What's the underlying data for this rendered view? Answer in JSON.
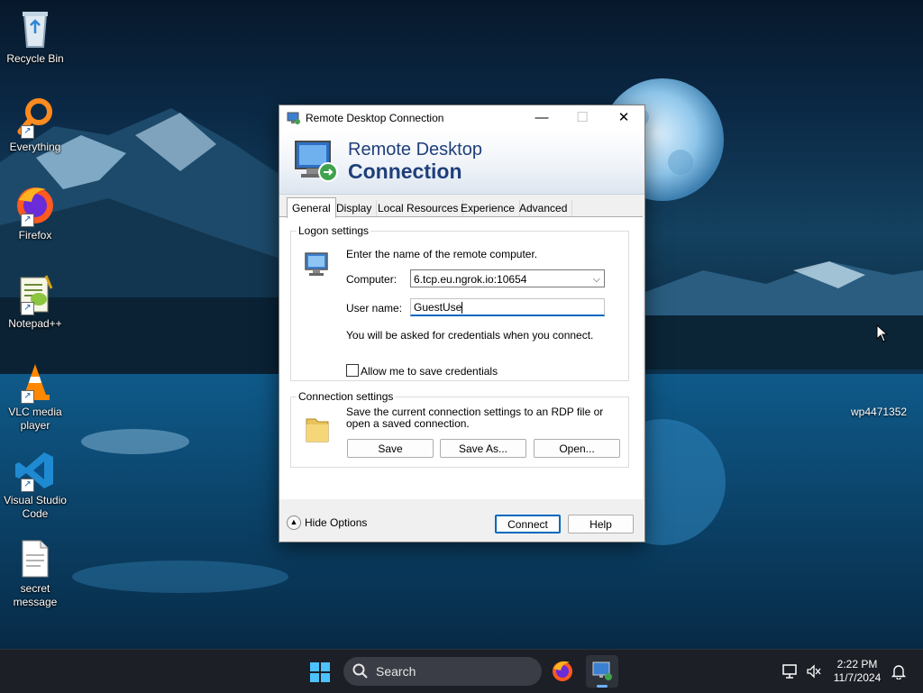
{
  "desktop": {
    "icons": [
      {
        "label": "Recycle Bin",
        "icon": "recycle-bin-icon"
      },
      {
        "label": "Everything",
        "icon": "everything-search-icon"
      },
      {
        "label": "Firefox",
        "icon": "firefox-icon"
      },
      {
        "label": "Notepad++",
        "icon": "notepad-plus-plus-icon"
      },
      {
        "label": "VLC media player",
        "icon": "vlc-cone-icon"
      },
      {
        "label": "Visual Studio Code",
        "icon": "vscode-icon"
      },
      {
        "label": "secret message",
        "icon": "text-document-icon"
      }
    ],
    "wallpaper_label": "wp4471352"
  },
  "window": {
    "title": "Remote Desktop Connection",
    "banner_line1": "Remote Desktop",
    "banner_line2": "Connection",
    "tabs": [
      {
        "label": "General",
        "active": true
      },
      {
        "label": "Display"
      },
      {
        "label": "Local Resources"
      },
      {
        "label": "Experience"
      },
      {
        "label": "Advanced"
      }
    ],
    "logon": {
      "legend": "Logon settings",
      "instruction": "Enter the name of the remote computer.",
      "computer_label": "Computer:",
      "computer_value": "6.tcp.eu.ngrok.io:10654",
      "username_label": "User name:",
      "username_value": "GuestUse",
      "credentials_note": "You will be asked for credentials when you connect.",
      "save_credentials_label": "Allow me to save credentials",
      "save_credentials_checked": false
    },
    "connection": {
      "legend": "Connection settings",
      "description": "Save the current connection settings to an RDP file or open a saved connection.",
      "save_label": "Save",
      "save_as_label": "Save As...",
      "open_label": "Open..."
    },
    "hide_options_label": "Hide Options",
    "connect_label": "Connect",
    "help_label": "Help"
  },
  "taskbar": {
    "search_label": "Search",
    "time": "2:22 PM",
    "date": "11/7/2024",
    "colors": {
      "background": "#1c1f26",
      "accent": "#0067c0"
    }
  }
}
